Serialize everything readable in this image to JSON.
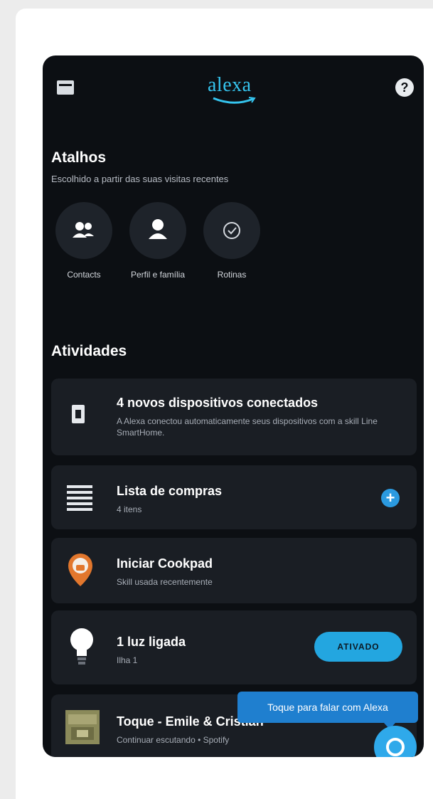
{
  "header": {
    "logo_text": "alexa",
    "menu_icon": "menu-icon",
    "help_icon": "help-icon",
    "help_glyph": "?"
  },
  "shortcuts": {
    "title": "Atalhos",
    "subtitle": "Escolhido a partir das suas visitas recentes",
    "items": [
      {
        "label": "Contacts",
        "icon": "contacts-icon"
      },
      {
        "label": "Perfil e família",
        "icon": "person-icon"
      },
      {
        "label": "Rotinas",
        "icon": "routines-icon"
      }
    ]
  },
  "activities": {
    "title": "Atividades",
    "items": [
      {
        "title": "4 novos dispositivos conectados",
        "subtitle": "A Alexa conectou automaticamente seus dispositivos com a skill Line SmartHome.",
        "icon": "device-icon"
      },
      {
        "title": "Lista de compras",
        "subtitle": "4 itens",
        "icon": "list-icon",
        "action": "+"
      },
      {
        "title": "Iniciar Cookpad",
        "subtitle": "Skill usada recentemente",
        "icon": "cookpad-icon"
      },
      {
        "title": "1 luz ligada",
        "subtitle": "Ilha 1",
        "icon": "lightbulb-icon",
        "action": "ATIVADO"
      },
      {
        "title": "Toque - Emile & Cristian",
        "subtitle": "Continuar escutando • Spotify",
        "icon": "album-art-icon"
      }
    ]
  },
  "tooltip": {
    "text": "Toque para falar com Alexa"
  },
  "colors": {
    "background": "#0c0f13",
    "tile": "#1a1e24",
    "accent": "#23a6e0",
    "logo": "#35c4ee"
  }
}
